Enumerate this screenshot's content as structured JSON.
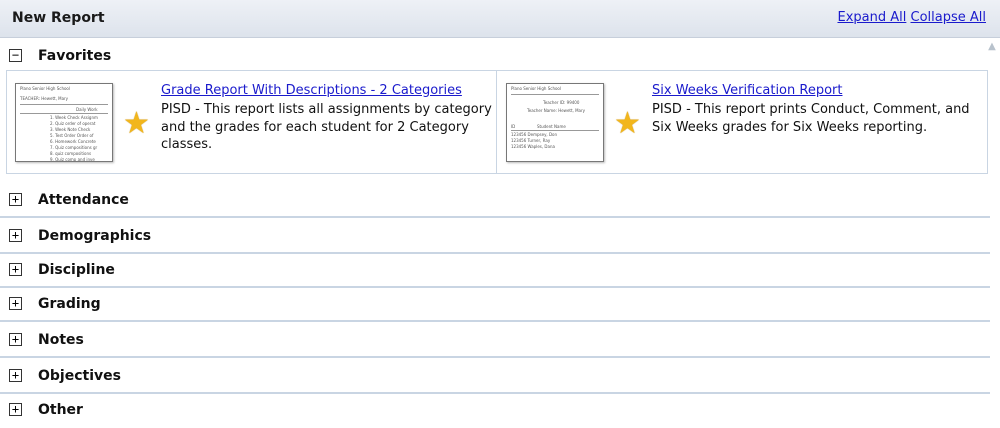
{
  "header": {
    "title": "New Report",
    "expand_all": "Expand All",
    "collapse_all": "Collapse All"
  },
  "favorites": {
    "label": "Favorites",
    "toggle": "−",
    "reports": [
      {
        "title": "Grade Report With Descriptions - 2 Categories",
        "description": "PISD - This report lists all assignments by category and the grades for each student for 2 Category classes.",
        "thumb_lines": [
          "Plano Senior High School",
          "TEACHER: Hewett, Mary",
          "Daily Work",
          "1. Week Check Assignm",
          "2. Quiz order of operat",
          "3. Week Note Check",
          "5. Test Order Order of",
          "6. Homework Concrete",
          "7. Quiz compositions gr",
          "8. quiz compositions",
          "9. Quiz comp and inve"
        ]
      },
      {
        "title": "Six Weeks Verification Report",
        "description": "PISD - This report prints Conduct, Comment, and Six Weeks grades for Six Weeks reporting.",
        "thumb_lines": [
          "Plano Senior High School",
          "Teacher ID: 99400",
          "Teacher Name: Hewett, Mary",
          "ID",
          "Student Name",
          "123456 Dempsey, Don",
          "123456 Turner, Ray",
          "123456 Waples, Dana"
        ]
      }
    ]
  },
  "sections": [
    {
      "label": "Attendance",
      "toggle": "+"
    },
    {
      "label": "Demographics",
      "toggle": "+"
    },
    {
      "label": "Discipline",
      "toggle": "+"
    },
    {
      "label": "Grading",
      "toggle": "+"
    },
    {
      "label": "Notes",
      "toggle": "+"
    },
    {
      "label": "Objectives",
      "toggle": "+"
    },
    {
      "label": "Other",
      "toggle": "+"
    }
  ],
  "colors": {
    "link": "#1a1acc",
    "star": "#f2b61c",
    "divider": "#c9d5e3"
  }
}
